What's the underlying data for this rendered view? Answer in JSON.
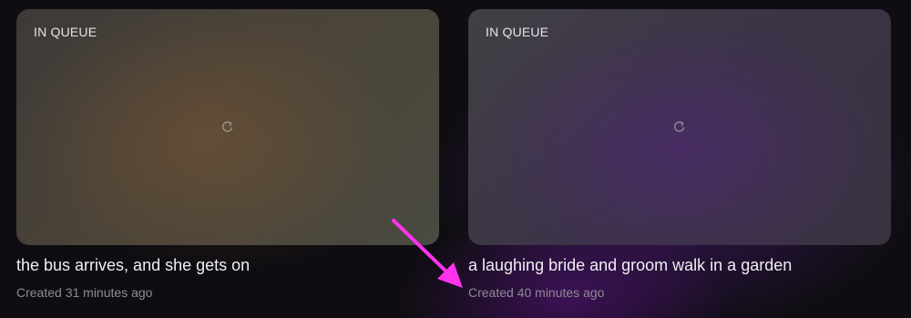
{
  "cards": [
    {
      "status": "IN QUEUE",
      "title": "the bus arrives, and she gets on",
      "created": "Created 31 minutes ago"
    },
    {
      "status": "IN QUEUE",
      "title": "a laughing bride and groom walk in a garden",
      "created": "Created 40 minutes ago"
    }
  ],
  "icons": {
    "loading": "reload-icon",
    "annotation": "arrow-annotation"
  },
  "colors": {
    "annotation_arrow": "#ff33ee",
    "title_text": "#efeef2",
    "meta_text": "#8f8b94"
  }
}
